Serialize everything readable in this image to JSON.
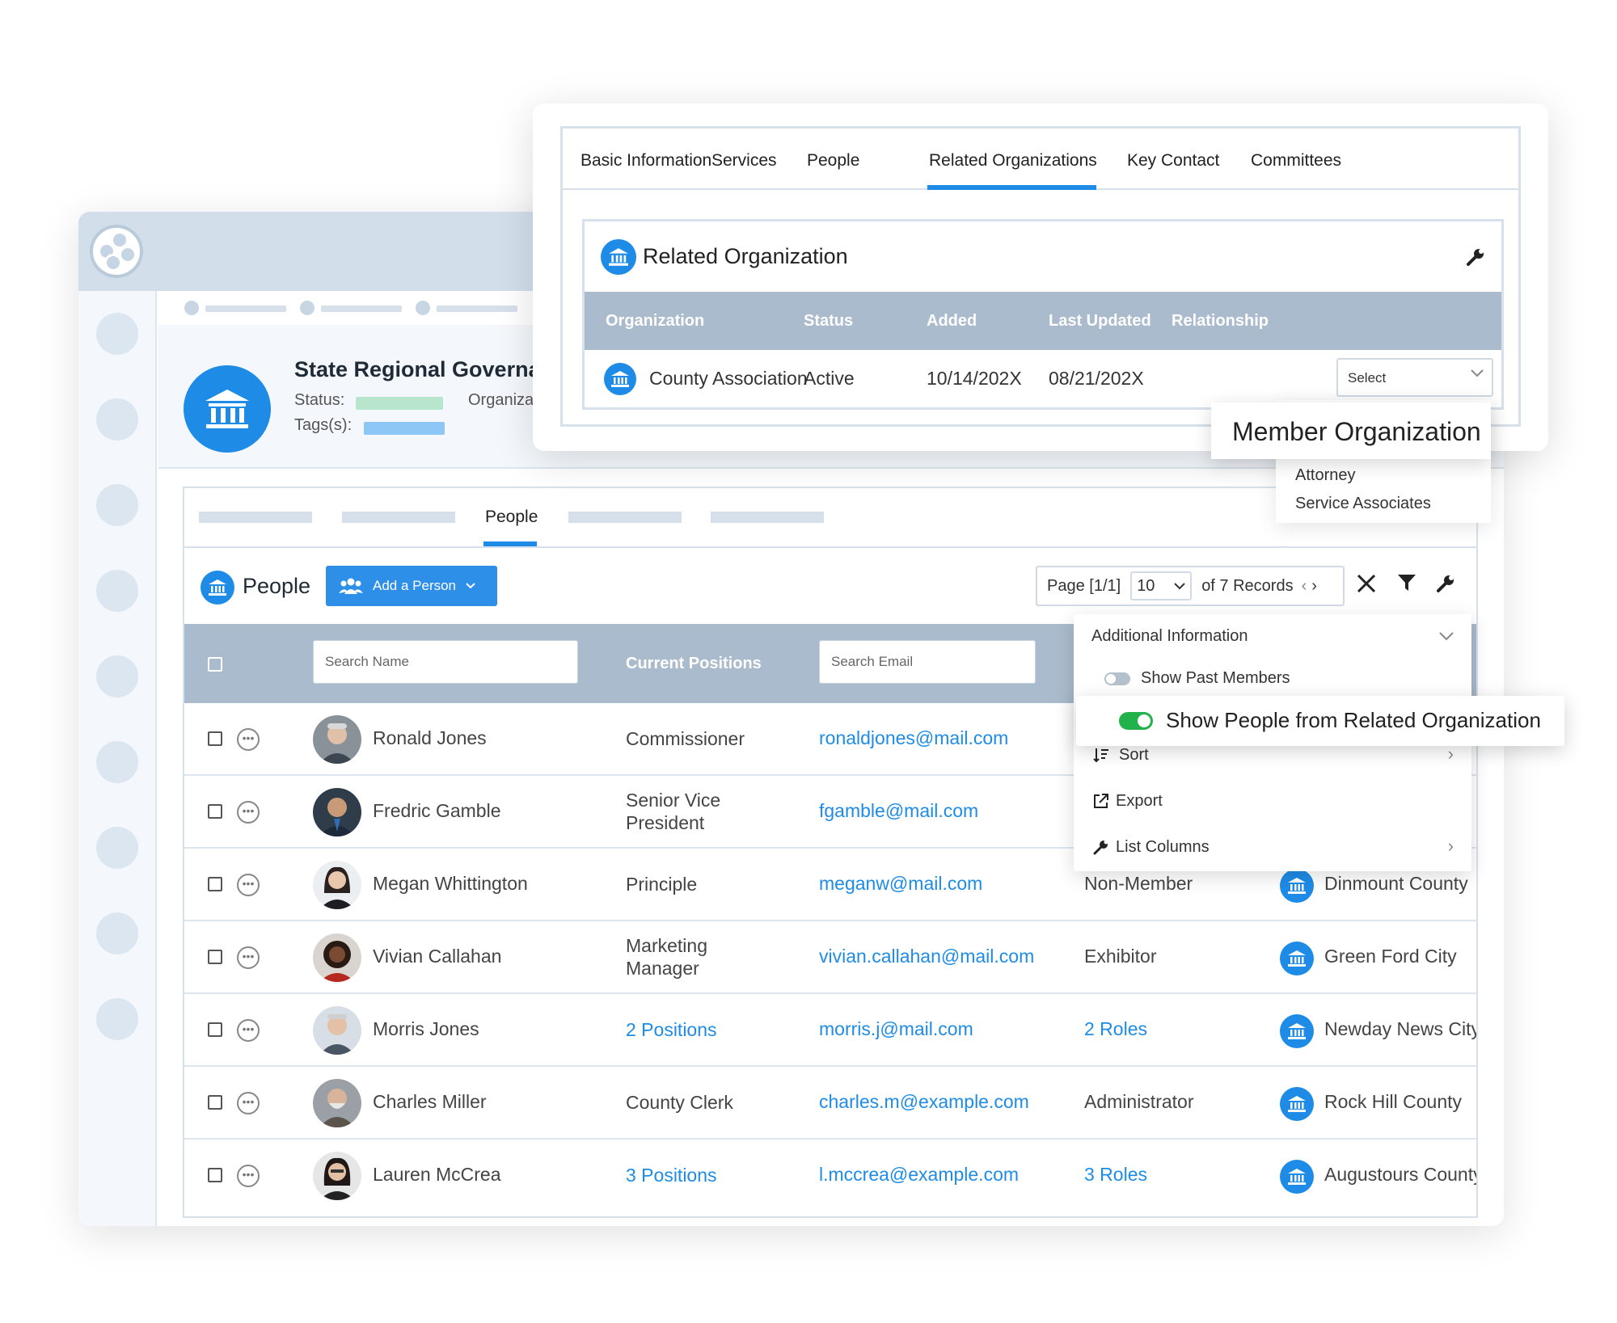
{
  "organization": {
    "name": "State Regional Governa",
    "status_label": "Status:",
    "org_label": "Organiza",
    "tags_label": "Tags(s):"
  },
  "people_tabs": {
    "active": "People"
  },
  "people_toolbar": {
    "title": "People",
    "add_button": "Add a Person",
    "page_label": "Page [1/1]",
    "page_size": "10",
    "records_label": "of 7 Records"
  },
  "people_table": {
    "search_name_placeholder": "Search Name",
    "positions_header": "Current Positions",
    "search_email_placeholder": "Search Email",
    "rows": [
      {
        "name": "Ronald Jones",
        "position": "Commissioner",
        "email": "ronaldjones@mail.com",
        "role": "",
        "org": ""
      },
      {
        "name": "Fredric Gamble",
        "position_line1": "Senior Vice",
        "position_line2": "President",
        "email": "fgamble@mail.com",
        "role": "",
        "org": ""
      },
      {
        "name": "Megan Whittington",
        "position": "Principle",
        "email": "meganw@mail.com",
        "role": "Non-Member",
        "org": "Dinmount County"
      },
      {
        "name": "Vivian Callahan",
        "position_line1": "Marketing",
        "position_line2": "Manager",
        "email": "vivian.callahan@mail.com",
        "role": "Exhibitor",
        "org": "Green Ford City"
      },
      {
        "name": "Morris Jones",
        "position": "2 Positions",
        "email": "morris.j@mail.com",
        "role": "2 Roles",
        "org": "Newday News City"
      },
      {
        "name": "Charles Miller",
        "position": "County Clerk",
        "email": "charles.m@example.com",
        "role": "Administrator",
        "org": "Rock Hill County"
      },
      {
        "name": "Lauren McCrea",
        "position": "3 Positions",
        "email": "l.mccrea@example.com",
        "role": "3 Roles",
        "org": "Augustours County"
      }
    ]
  },
  "options_menu": {
    "additional_info": "Additional Information",
    "show_past_members": "Show Past Members",
    "show_related": "Show People from Related Organization",
    "sort": "Sort",
    "export": "Export",
    "list_columns": "List Columns"
  },
  "org_tabs": [
    "Basic Information",
    "Services",
    "People",
    "Related Organizations",
    "Key Contact",
    "Committees"
  ],
  "related_org": {
    "title": "Related Organization",
    "headers": [
      "Organization",
      "Status",
      "Added",
      "Last Updated",
      "Relationship"
    ],
    "row": {
      "organization": "County Association",
      "status": "Active",
      "added": "10/14/202X",
      "last_updated": "08/21/202X",
      "relationship": "Select"
    },
    "dropdown": [
      "Member Organization",
      "Attorney",
      "Service Associates"
    ]
  },
  "colors": {
    "accent": "#1e8ce6",
    "header": "#aabbcd",
    "toggle_on": "#22b24c"
  }
}
